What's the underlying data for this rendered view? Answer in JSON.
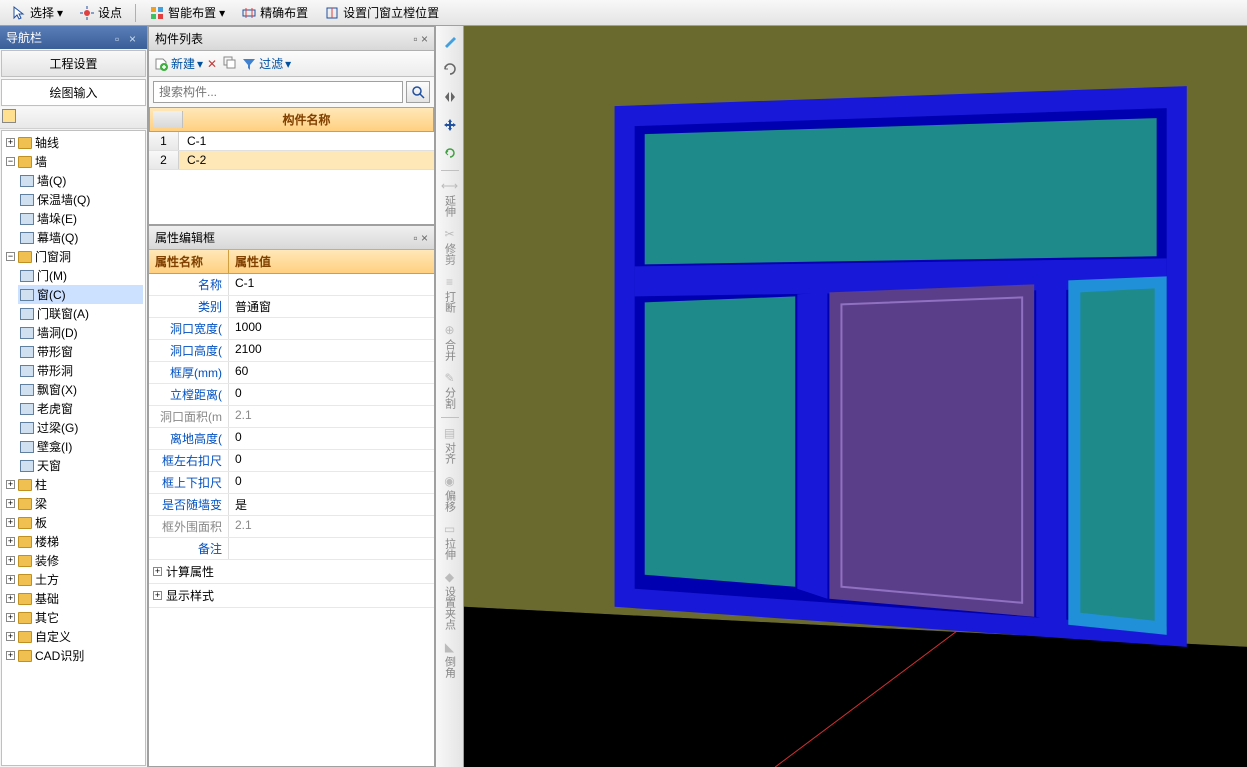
{
  "nav": {
    "title": "导航栏",
    "tabs": {
      "project": "工程设置",
      "draw": "绘图输入"
    }
  },
  "tree": {
    "axis": "轴线",
    "wall": "墙",
    "wall_items": {
      "q": "墙(Q)",
      "insul": "保温墙(Q)",
      "duo": "墙垛(E)",
      "curtain": "幕墙(Q)"
    },
    "opening": "门窗洞",
    "opening_items": {
      "door": "门(M)",
      "window": "窗(C)",
      "dw": "门联窗(A)",
      "hole": "墙洞(D)",
      "strip": "带形窗",
      "strip_hole": "带形洞",
      "bay": "飘窗(X)",
      "dormer": "老虎窗",
      "lintel": "过梁(G)",
      "niche": "壁龛(I)",
      "sky": "天窗"
    },
    "column": "柱",
    "beam": "梁",
    "slab": "板",
    "stair": "楼梯",
    "deco": "装修",
    "earth": "土方",
    "found": "基础",
    "other": "其它",
    "custom": "自定义",
    "cad": "CAD识别"
  },
  "complist": {
    "title": "构件列表",
    "new": "新建",
    "filter": "过滤",
    "search_placeholder": "搜索构件...",
    "header": "构件名称",
    "rows": [
      {
        "n": "1",
        "name": "C-1"
      },
      {
        "n": "2",
        "name": "C-2"
      }
    ]
  },
  "props": {
    "title": "属性编辑框",
    "header_name": "属性名称",
    "header_val": "属性值",
    "rows": [
      {
        "k": "名称",
        "v": "C-1"
      },
      {
        "k": "类别",
        "v": "普通窗"
      },
      {
        "k": "洞口宽度(",
        "v": "1000"
      },
      {
        "k": "洞口高度(",
        "v": "2100"
      },
      {
        "k": "框厚(mm)",
        "v": "60"
      },
      {
        "k": "立樘距离(",
        "v": "0"
      },
      {
        "k": "洞口面积(m",
        "v": "2.1",
        "gray": true
      },
      {
        "k": "离地高度(",
        "v": "0"
      },
      {
        "k": "框左右扣尺",
        "v": "0"
      },
      {
        "k": "框上下扣尺",
        "v": "0"
      },
      {
        "k": "是否随墙变",
        "v": "是"
      },
      {
        "k": "框外围面积",
        "v": "2.1",
        "gray": true
      },
      {
        "k": "备注",
        "v": ""
      }
    ],
    "group_calc": "计算属性",
    "group_disp": "显示样式"
  },
  "toolbar": {
    "select": "选择",
    "point": "设点",
    "smart": "智能布置",
    "precise": "精确布置",
    "setpos": "设置门窗立樘位置"
  },
  "vtools": {
    "extend": "延伸",
    "trim": "修剪",
    "break": "打断",
    "merge": "合并",
    "split": "分割",
    "align": "对齐",
    "offset": "偏移",
    "stretch": "拉伸",
    "grip": "设置夹点",
    "chamfer": "倒角"
  }
}
